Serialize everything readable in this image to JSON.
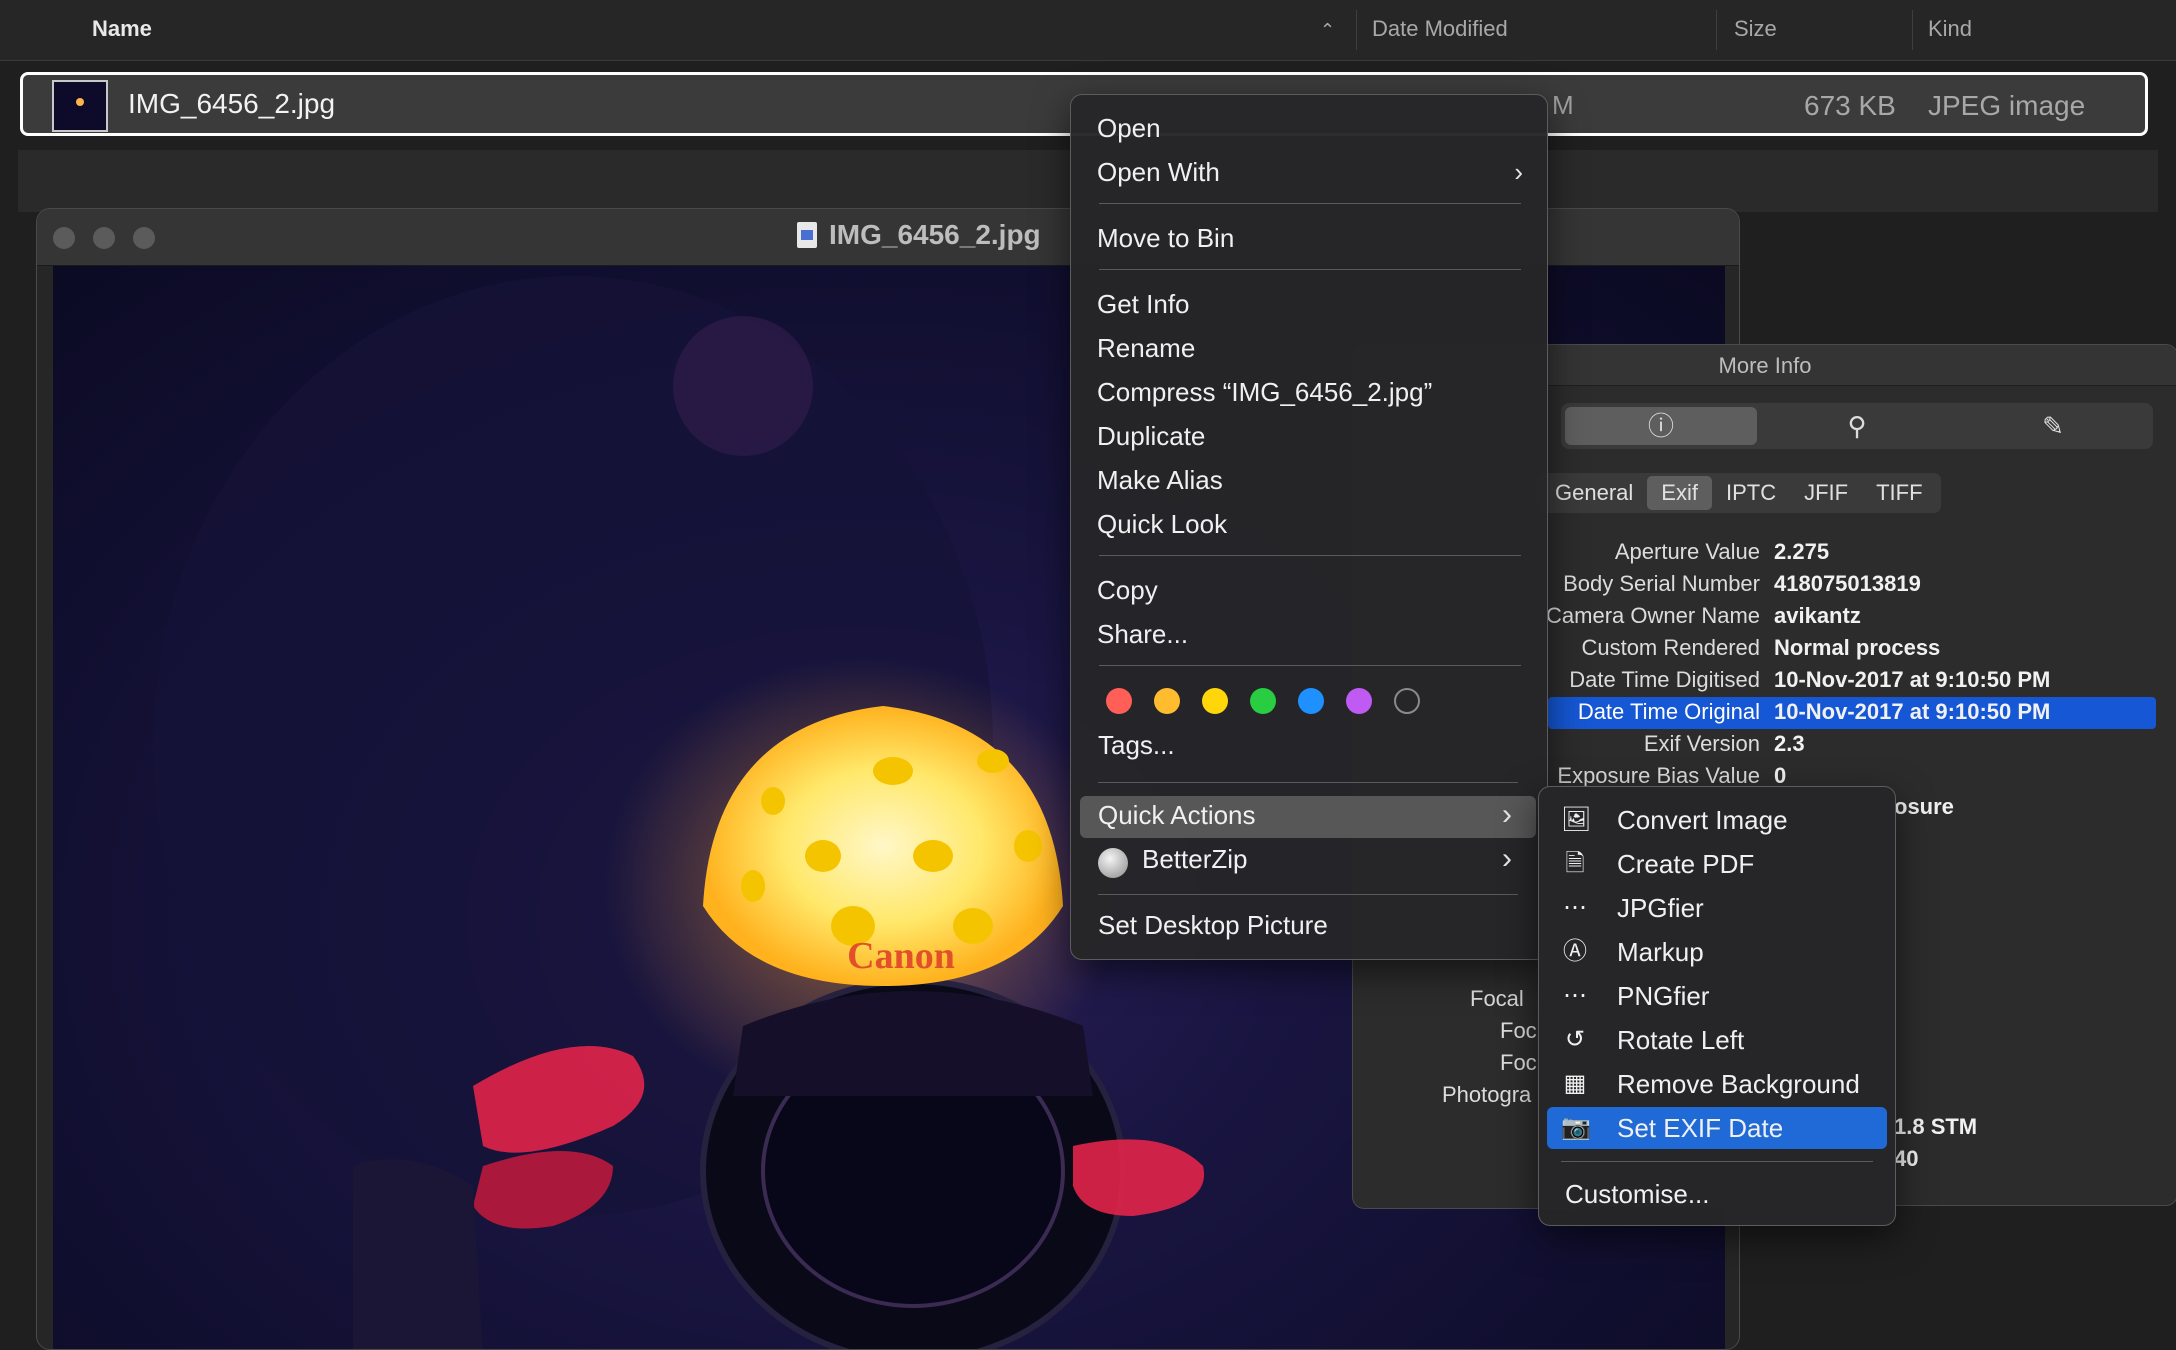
{
  "finder": {
    "columns": {
      "name": "Name",
      "date_modified": "Date Modified",
      "size": "Size",
      "kind": "Kind"
    },
    "file": {
      "name": "IMG_6456_2.jpg",
      "date_fragment": "M",
      "size": "673 KB",
      "kind": "JPEG image"
    }
  },
  "preview": {
    "title": "IMG_6456_2.jpg",
    "photo_text": "Canon"
  },
  "info_panel": {
    "title": "More Info",
    "toolbar_icons": [
      "info-icon",
      "search-icon",
      "pencil-icon"
    ],
    "tabs": [
      "General",
      "Exif",
      "IPTC",
      "JFIF",
      "TIFF"
    ],
    "selected_tab": "Exif",
    "rows": [
      {
        "key": "Aperture Value",
        "value": "2.275"
      },
      {
        "key": "Body Serial Number",
        "value": "418075013819"
      },
      {
        "key": "Camera Owner Name",
        "value": "avikantz"
      },
      {
        "key": "Custom Rendered",
        "value": "Normal process"
      },
      {
        "key": "Date Time Digitised",
        "value": "10-Nov-2017 at 9:10:50 PM"
      },
      {
        "key": "Date Time Original",
        "value": "10-Nov-2017 at 9:10:50 PM"
      },
      {
        "key": "Exif Version",
        "value": "2.3"
      },
      {
        "key": "Exposure Bias Value",
        "value": "0"
      }
    ],
    "partial_right": [
      "osure",
      "1.8 STM",
      "40"
    ],
    "partial_left": [
      "Focal",
      "Foc",
      "Foc",
      "Photogra"
    ]
  },
  "context_menu": {
    "open": "Open",
    "open_with": "Open With",
    "move_to_bin": "Move to Bin",
    "get_info": "Get Info",
    "rename": "Rename",
    "compress": "Compress “IMG_6456_2.jpg”",
    "duplicate": "Duplicate",
    "make_alias": "Make Alias",
    "quick_look": "Quick Look",
    "copy": "Copy",
    "share": "Share...",
    "tag_colors": [
      "#ff5f57",
      "#febc2e",
      "#ffd60a",
      "#28cd41",
      "#1e90ff",
      "#bf5af2",
      "none"
    ],
    "tags": "Tags...",
    "quick_actions": "Quick Actions",
    "betterzip": "BetterZip",
    "set_desktop_picture": "Set Desktop Picture"
  },
  "quick_actions_menu": {
    "items": [
      {
        "label": "Convert Image",
        "icon": "convert-image-icon"
      },
      {
        "label": "Create PDF",
        "icon": "document-icon"
      },
      {
        "label": "JPGfier",
        "icon": "ellipsis-circle-icon"
      },
      {
        "label": "Markup",
        "icon": "markup-icon"
      },
      {
        "label": "PNGfier",
        "icon": "ellipsis-circle-icon"
      },
      {
        "label": "Rotate Left",
        "icon": "rotate-left-icon"
      },
      {
        "label": "Remove Background",
        "icon": "remove-background-icon"
      },
      {
        "label": "Set EXIF Date",
        "icon": "camera-icon"
      }
    ],
    "selected": "Set EXIF Date",
    "customise": "Customise..."
  }
}
